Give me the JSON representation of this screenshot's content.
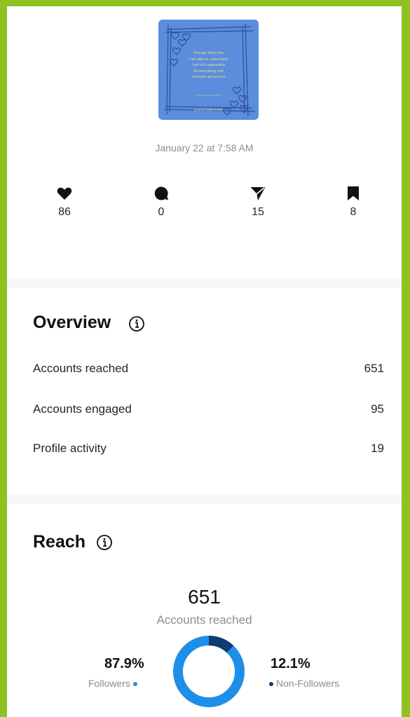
{
  "post": {
    "quote_lines": [
      "Through Step One",
      "I am able to understand",
      "I am not responsible",
      "for everything and",
      "everyone around me"
    ],
    "quote_signature": "Al-Anon Family Groups",
    "date": "January 22 at 7:58 AM"
  },
  "stats": [
    {
      "icon": "heart-icon",
      "value": "86"
    },
    {
      "icon": "comment-icon",
      "value": "0"
    },
    {
      "icon": "share-icon",
      "value": "15"
    },
    {
      "icon": "bookmark-icon",
      "value": "8"
    }
  ],
  "overview": {
    "title": "Overview",
    "rows": [
      {
        "label": "Accounts reached",
        "value": "651"
      },
      {
        "label": "Accounts engaged",
        "value": "95"
      },
      {
        "label": "Profile activity",
        "value": "19"
      }
    ]
  },
  "reach": {
    "title": "Reach",
    "total": "651",
    "total_label": "Accounts reached",
    "followers": {
      "percent": "87.9%",
      "label": "Followers",
      "fraction": 0.879
    },
    "non_followers": {
      "percent": "12.1%",
      "label": "Non-Followers",
      "fraction": 0.121
    }
  },
  "colors": {
    "frame": "#8dc21f",
    "followers": "#1d8fe8",
    "non_followers": "#0f3c6e",
    "thumbnail": "#5a8ddc"
  }
}
